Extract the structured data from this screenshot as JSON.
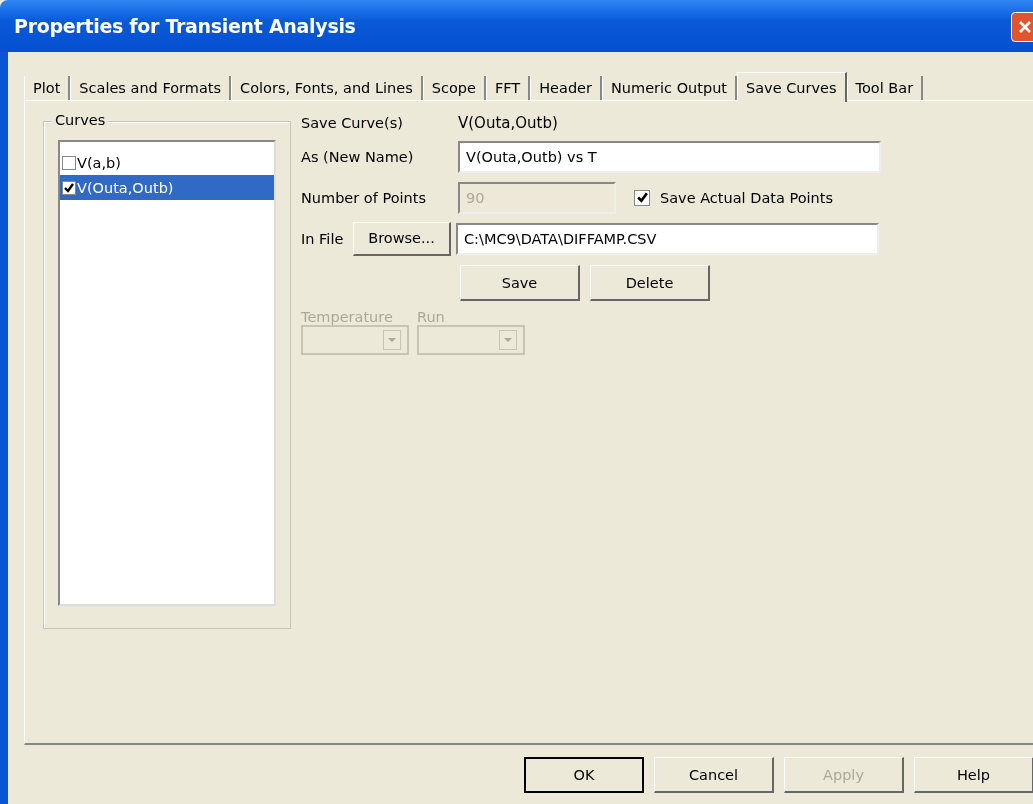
{
  "window": {
    "title": "Properties for Transient Analysis"
  },
  "tabs": [
    {
      "label": "Plot",
      "selected": false
    },
    {
      "label": "Scales and Formats",
      "selected": false
    },
    {
      "label": "Colors, Fonts, and Lines",
      "selected": false
    },
    {
      "label": "Scope",
      "selected": false
    },
    {
      "label": "FFT",
      "selected": false
    },
    {
      "label": "Header",
      "selected": false
    },
    {
      "label": "Numeric Output",
      "selected": false
    },
    {
      "label": "Save Curves",
      "selected": true
    },
    {
      "label": "Tool Bar",
      "selected": false
    }
  ],
  "curves": {
    "title": "Curves",
    "items": [
      {
        "label": "V(a,b)",
        "checked": false,
        "selected": false
      },
      {
        "label": "V(Outa,Outb)",
        "checked": true,
        "selected": true
      }
    ]
  },
  "save_curves": {
    "label": "Save Curve(s)",
    "value": "V(Outa,Outb)"
  },
  "new_name": {
    "label": "As (New Name)",
    "value": "V(Outa,Outb) vs T"
  },
  "number_of_points": {
    "label": "Number of Points",
    "value": "90",
    "disabled": true
  },
  "save_actual": {
    "label": "Save Actual Data Points",
    "checked": true
  },
  "in_file": {
    "label": "In File",
    "button": "Browse...",
    "value": "C:\\MC9\\DATA\\DIFFAMP.CSV"
  },
  "actions": [
    {
      "label": "Save"
    },
    {
      "label": "Delete"
    }
  ],
  "dropdowns": [
    {
      "label": "Temperature",
      "disabled": true
    },
    {
      "label": "Run",
      "disabled": true
    }
  ],
  "buttons": [
    {
      "label": "OK",
      "default": true,
      "disabled": false
    },
    {
      "label": "Cancel",
      "default": false,
      "disabled": false
    },
    {
      "label": "Apply",
      "default": false,
      "disabled": true
    },
    {
      "label": "Help",
      "default": false,
      "disabled": false
    }
  ]
}
